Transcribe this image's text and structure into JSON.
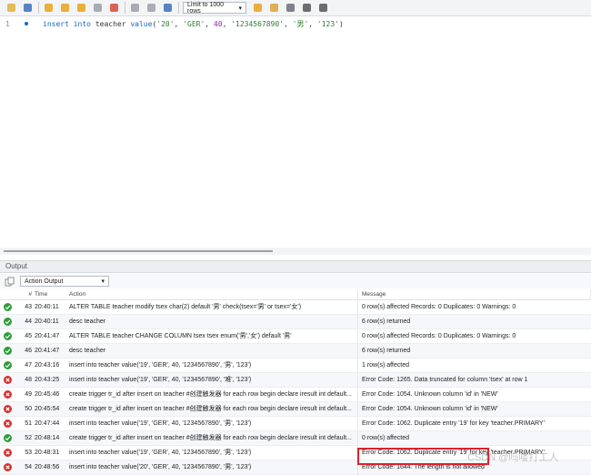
{
  "toolbar": {
    "limit_label": "Limit to 1000 rows",
    "icons": [
      "folder-icon",
      "save-icon",
      "execute-icon",
      "execute-current-icon",
      "explain-icon",
      "stop-icon",
      "toggle-error-icon",
      "commit-icon",
      "rollback-icon",
      "auto-commit-icon",
      "bookmark-icon",
      "beautify-icon",
      "find-icon",
      "invisible-chars-icon",
      "wrap-icon"
    ]
  },
  "editor": {
    "line_number": "1",
    "tokens": [
      {
        "t": "insert",
        "c": "kw"
      },
      {
        "t": " ",
        "c": "plain"
      },
      {
        "t": "into",
        "c": "kw"
      },
      {
        "t": " teacher ",
        "c": "plain"
      },
      {
        "t": "value",
        "c": "kw"
      },
      {
        "t": "(",
        "c": "plain"
      },
      {
        "t": "'20'",
        "c": "str"
      },
      {
        "t": ", ",
        "c": "plain"
      },
      {
        "t": "'GER'",
        "c": "str"
      },
      {
        "t": ", ",
        "c": "plain"
      },
      {
        "t": "40",
        "c": "num"
      },
      {
        "t": ", ",
        "c": "plain"
      },
      {
        "t": "'1234567890'",
        "c": "str"
      },
      {
        "t": ", ",
        "c": "plain"
      },
      {
        "t": "'男'",
        "c": "str"
      },
      {
        "t": ", ",
        "c": "plain"
      },
      {
        "t": "'123'",
        "c": "str"
      },
      {
        "t": ")",
        "c": "plain"
      }
    ]
  },
  "output": {
    "title": "Output",
    "selector": "Action Output",
    "columns": {
      "num": "#",
      "time": "Time",
      "action": "Action",
      "message": "Message"
    },
    "rows": [
      {
        "status": "ok",
        "num": "43",
        "time": "20:40:11",
        "action": "ALTER TABLE teacher modify tsex char(2) default '男' check(tsex='男' or tsex='女')",
        "message": "0 row(s) affected Records: 0  Duplicates: 0  Warnings: 0"
      },
      {
        "status": "ok",
        "num": "44",
        "time": "20:40:11",
        "action": "desc teacher",
        "message": "6 row(s) returned"
      },
      {
        "status": "ok",
        "num": "45",
        "time": "20:41:47",
        "action": "ALTER TABLE teacher CHANGE COLUMN tsex tsex enum('男','女') default '男'",
        "message": "0 row(s) affected Records: 0  Duplicates: 0  Warnings: 0"
      },
      {
        "status": "ok",
        "num": "46",
        "time": "20:41:47",
        "action": "desc teacher",
        "message": "6 row(s) returned"
      },
      {
        "status": "ok",
        "num": "47",
        "time": "20:43:16",
        "action": "insert into teacher value('19', 'GER', 40, '1234567890', '男', '123')",
        "message": "1 row(s) affected"
      },
      {
        "status": "err",
        "num": "48",
        "time": "20:43:25",
        "action": "insert into teacher value('19', 'GER', 40, '1234567890', '难', '123')",
        "message": "Error Code: 1265. Data truncated for column 'tsex' at row 1"
      },
      {
        "status": "err",
        "num": "49",
        "time": "20:45:46",
        "action": "create trigger tr_id after insert on teacher  #创建触发器 for each row begin declare iresult int default...",
        "message": "Error Code: 1054. Unknown column 'id' in 'NEW'"
      },
      {
        "status": "err",
        "num": "50",
        "time": "20:45:54",
        "action": "create trigger tr_id after insert on teacher  #创建触发器 for each row begin declare iresult int default...",
        "message": "Error Code: 1054. Unknown column 'id' in 'NEW'"
      },
      {
        "status": "err",
        "num": "51",
        "time": "20:47:44",
        "action": "insert into teacher value('19', 'GER', 40, '1234567890', '男', '123')",
        "message": "Error Code: 1062. Duplicate entry '19' for key 'teacher.PRIMARY'"
      },
      {
        "status": "ok",
        "num": "52",
        "time": "20:48:14",
        "action": "create trigger tr_id after insert on teacher  #创建触发器 for each row begin declare iresult int default...",
        "message": "0 row(s) affected"
      },
      {
        "status": "err",
        "num": "53",
        "time": "20:48:31",
        "action": "insert into teacher value('19', 'GER', 40, '1234567890', '男', '123')",
        "message": "Error Code: 1062. Duplicate entry '19' for key 'teacher.PRIMARY'"
      },
      {
        "status": "err",
        "num": "54",
        "time": "20:48:56",
        "action": "insert into teacher value('20', 'GER', 40, '1234567890', '男', '123')",
        "message": "Error Code: 1644. The length is not allowed"
      }
    ]
  },
  "watermark": "CSDN @吗喽打工人",
  "colors": {
    "ok": "#2e9d3a",
    "err": "#d9302c",
    "highlight": "#e0202a"
  }
}
